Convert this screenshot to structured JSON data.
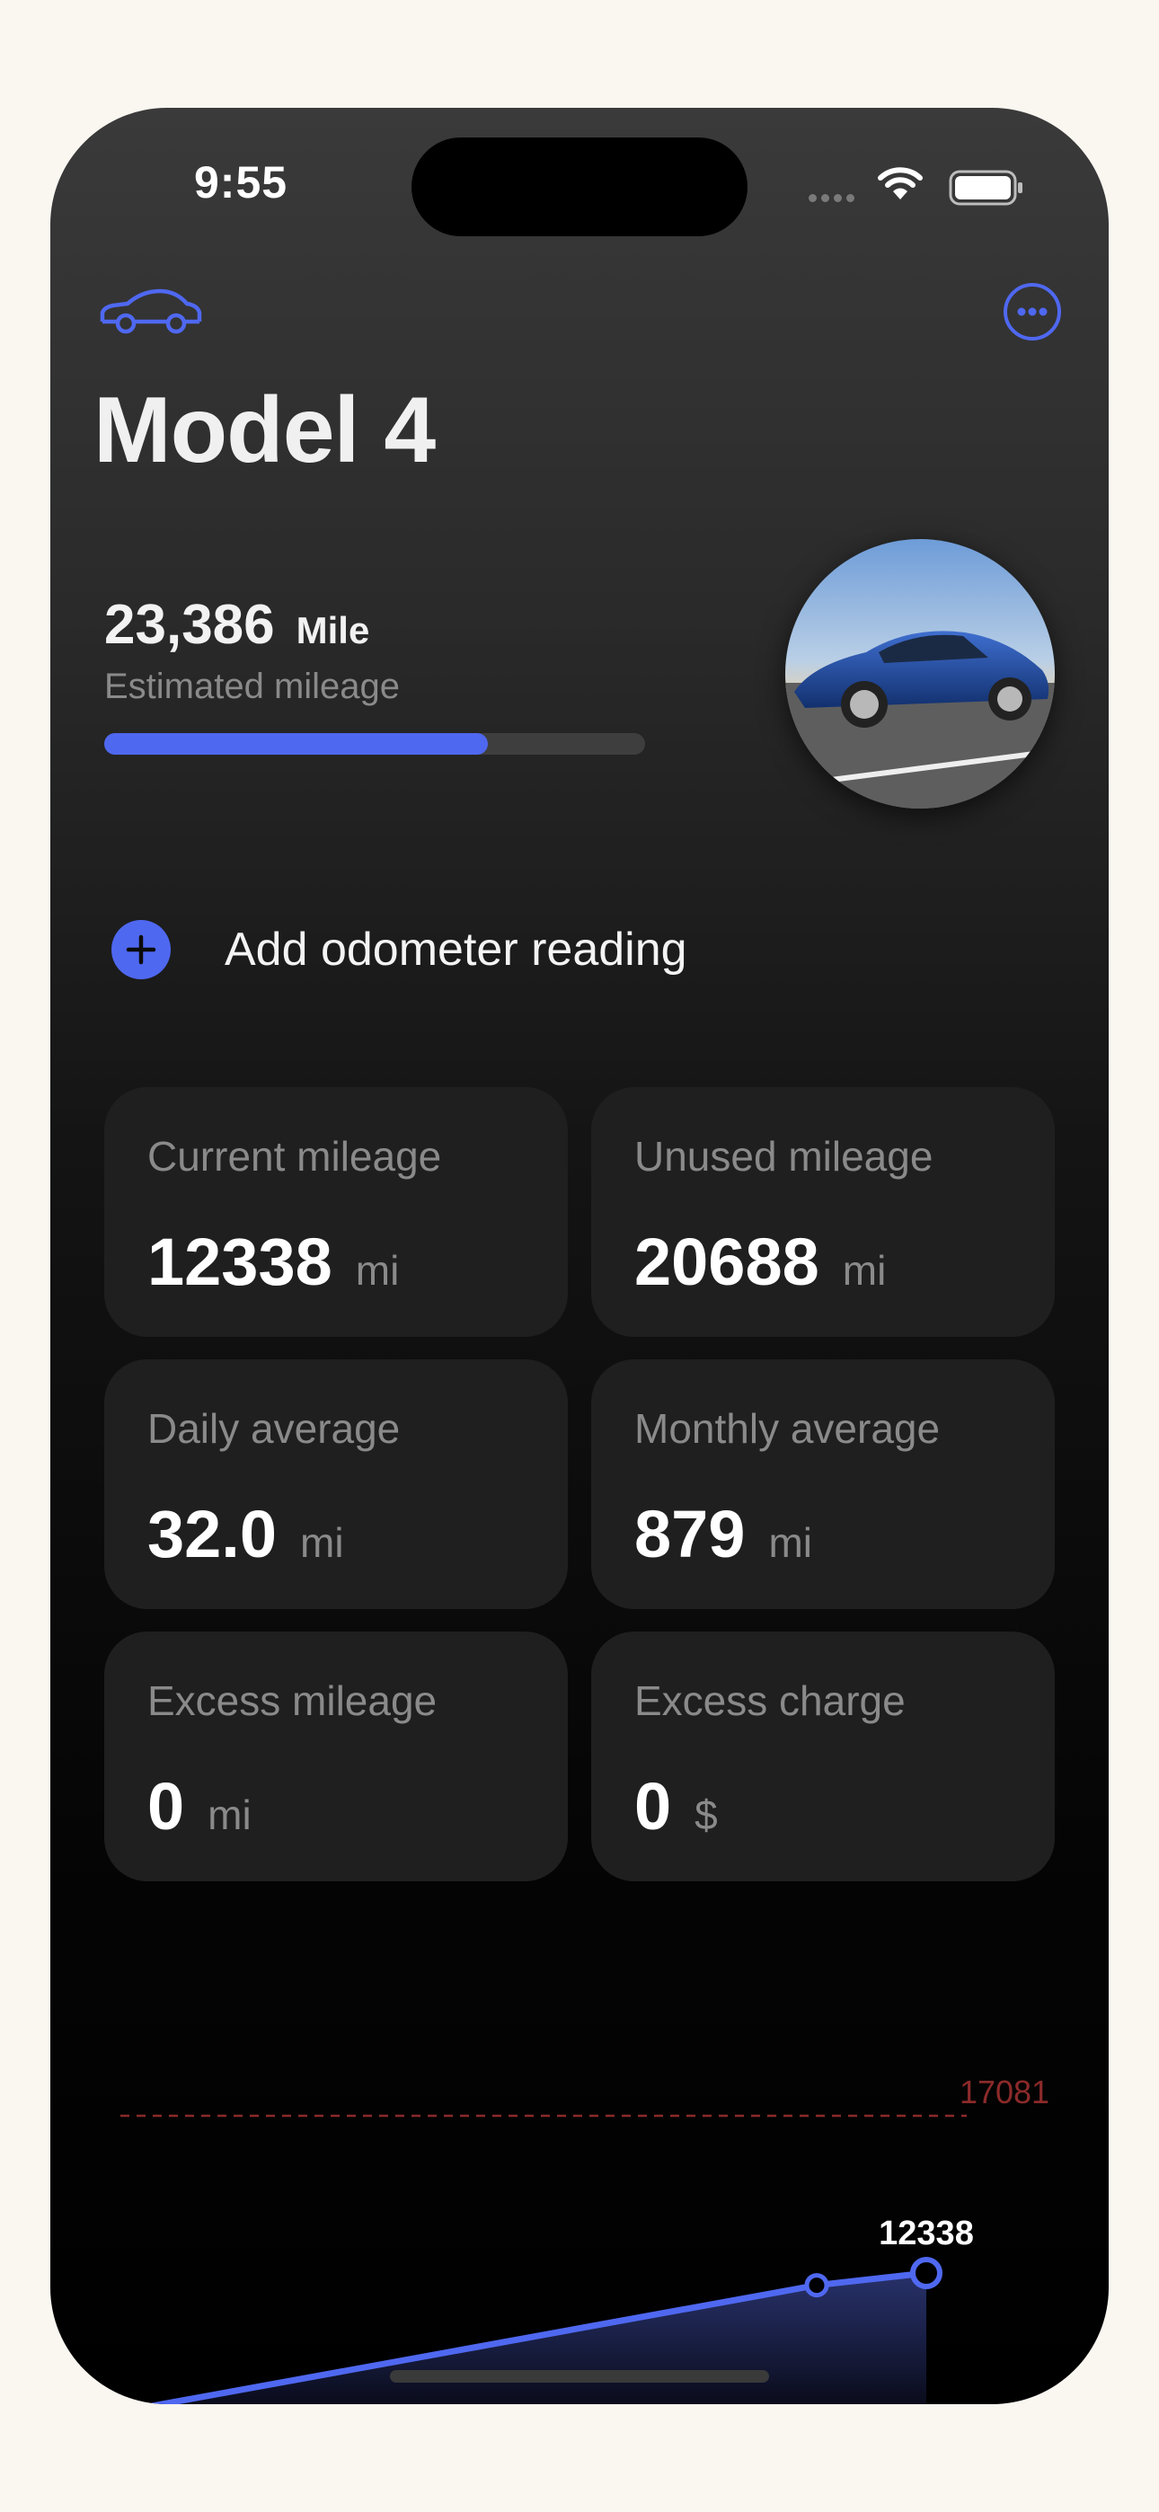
{
  "status_bar": {
    "time": "9:55"
  },
  "header": {
    "title": "Model 4"
  },
  "summary": {
    "estimated_mileage": "23,386",
    "unit": "Mile",
    "caption": "Estimated mileage",
    "progress_fraction": 0.71
  },
  "add_reading": {
    "label": "Add odometer reading"
  },
  "stats": [
    {
      "label": "Current mileage",
      "value": "12338",
      "unit": "mi"
    },
    {
      "label": "Unused mileage",
      "value": "20688",
      "unit": "mi"
    },
    {
      "label": "Daily average",
      "value": "32.0",
      "unit": "mi"
    },
    {
      "label": "Monthly average",
      "value": "879",
      "unit": "mi"
    },
    {
      "label": "Excess mileage",
      "value": "0",
      "unit": "mi"
    },
    {
      "label": "Excess charge",
      "value": "0",
      "unit": "$"
    }
  ],
  "chart_data": {
    "type": "area",
    "title": "",
    "xlabel": "",
    "ylabel": "",
    "limit_value": 17081,
    "limit_label": "17081",
    "last_value_label": "12338",
    "ylim": [
      0,
      17081
    ],
    "series": [
      {
        "values": [
          7770,
          11970,
          12338
        ]
      }
    ],
    "colors": {
      "line": "#4f68f0",
      "limit": "#8b2a2a",
      "points": "#4f68f0"
    }
  },
  "icons": {
    "car": "car-icon",
    "more": "ellipsis-circle-icon",
    "add": "plus-circle-icon",
    "wifi": "wifi-icon",
    "battery": "battery-icon"
  },
  "colors": {
    "accent": "#4f68f0",
    "background": "#faf6f0"
  }
}
